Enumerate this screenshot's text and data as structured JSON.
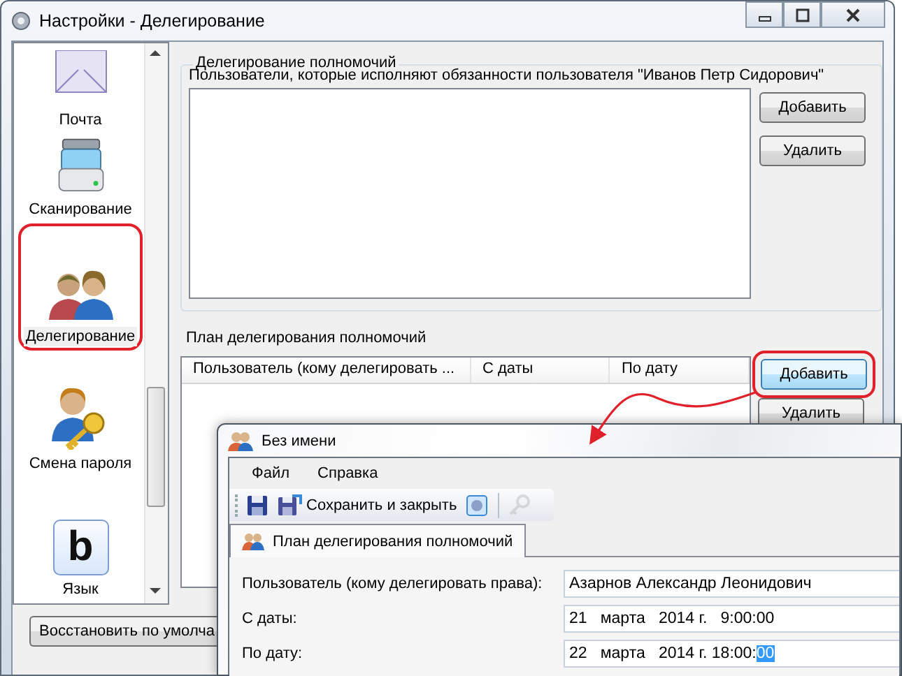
{
  "window": {
    "title": "Настройки - Делегирование"
  },
  "sidebar": {
    "items": [
      {
        "label": "Почта",
        "kind": "mail",
        "selected": false,
        "annotated": false
      },
      {
        "label": "Сканирование",
        "kind": "scanner",
        "selected": false,
        "annotated": false
      },
      {
        "label": "Делегирование",
        "kind": "users",
        "selected": true,
        "annotated": true
      },
      {
        "label": "Смена пароля",
        "kind": "user-key",
        "selected": false,
        "annotated": false
      },
      {
        "label": "Язык",
        "kind": "letter",
        "icon_text": "b",
        "selected": false,
        "annotated": false
      }
    ]
  },
  "delegation": {
    "legend": "Делегирование полномочий",
    "description": "Пользователи, которые исполняют обязанности пользователя \"Иванов Петр Сидорович\"",
    "buttons": [
      {
        "label": "Добавить",
        "annotated": false
      },
      {
        "label": "Удалить",
        "annotated": false
      }
    ]
  },
  "plan": {
    "title": "План делегирования полномочий",
    "columns": [
      "Пользователь (кому делегировать ...",
      "С даты",
      "По дату"
    ],
    "buttons": [
      {
        "label": "Добавить",
        "annotated": true
      },
      {
        "label": "Удалить",
        "annotated": false
      }
    ]
  },
  "restore_button": "Восстановить по умолча",
  "dialog": {
    "title": "Без имени",
    "menu": [
      "Файл",
      "Справка"
    ],
    "toolbar": [
      {
        "kind": "save",
        "disabled": false
      },
      {
        "kind": "save-close",
        "label": "Сохранить и закрыть",
        "disabled": false
      },
      {
        "kind": "settings",
        "disabled": false
      },
      {
        "kind": "separator"
      },
      {
        "kind": "key",
        "disabled": true
      }
    ],
    "tabs": [
      {
        "label": "План делегирования полномочий",
        "selected": true
      }
    ],
    "fields": [
      {
        "label": "Пользователь (кому делегировать права):",
        "value": "Азарнов Александр Леонидович"
      },
      {
        "label": "С даты:",
        "value": "21   марта   2014 г.   9:00:00"
      },
      {
        "label": "По дату:",
        "value": "22   марта   2014 г. 18:00:",
        "selection": "00"
      }
    ]
  }
}
